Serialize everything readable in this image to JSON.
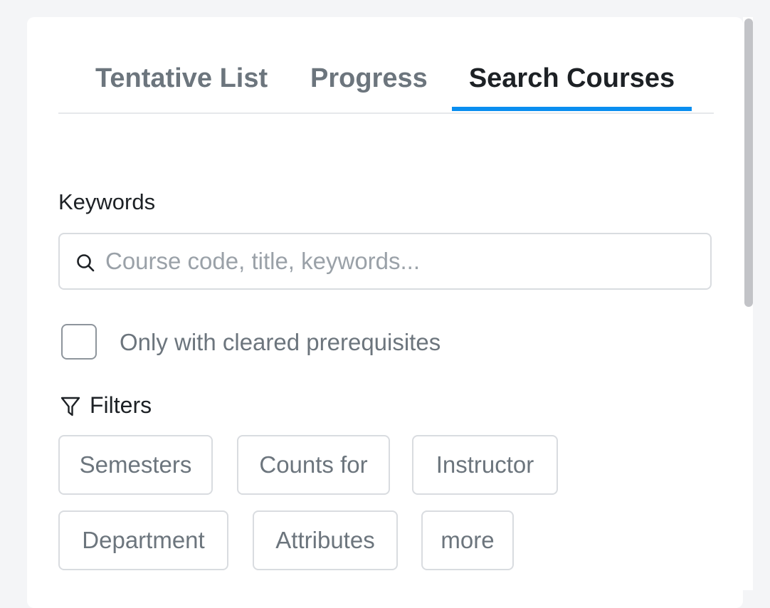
{
  "tabs": [
    {
      "label": "Tentative List",
      "active": false
    },
    {
      "label": "Progress",
      "active": false
    },
    {
      "label": "Search Courses",
      "active": true
    }
  ],
  "search": {
    "label": "Keywords",
    "placeholder": "Course code, title, keywords...",
    "value": "",
    "icon": "search-icon"
  },
  "prerequisites_checkbox": {
    "label": "Only with cleared prerequisites",
    "checked": false
  },
  "filters": {
    "heading": "Filters",
    "icon": "filter-icon",
    "chips": [
      {
        "label": "Semesters"
      },
      {
        "label": "Counts for"
      },
      {
        "label": "Instructor"
      },
      {
        "label": "Department"
      },
      {
        "label": "Attributes"
      },
      {
        "label": "more"
      }
    ]
  },
  "colors": {
    "accent": "#0a8ef0",
    "active_text": "#1d2125",
    "muted_text": "#6c757d",
    "border": "#d9dce0"
  }
}
